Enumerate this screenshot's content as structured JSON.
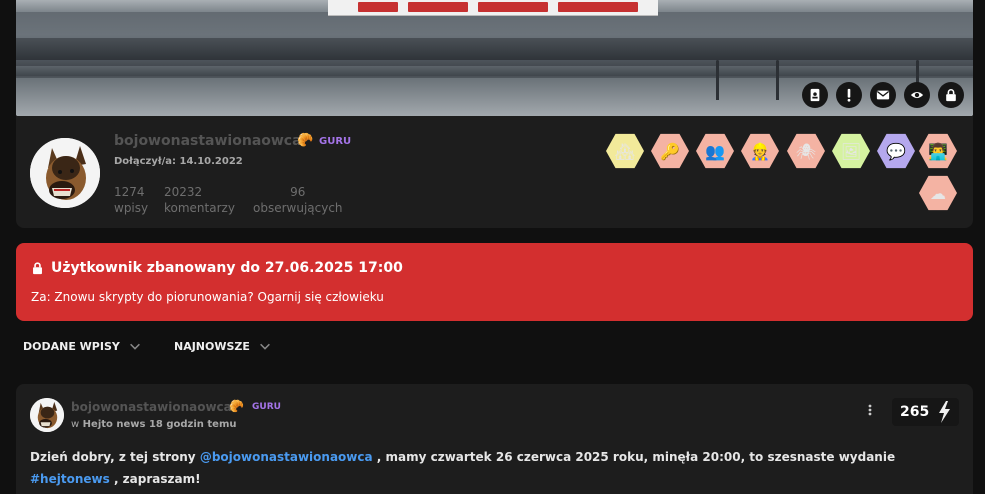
{
  "profile": {
    "username": "bojowonastawionaowca",
    "rank": "GURU",
    "joined": "Dołączył/a: 14.10.2022",
    "stats": [
      {
        "value": "1274",
        "label": "wpisy"
      },
      {
        "value": "20232",
        "label": "komentarzy"
      },
      {
        "value": "96",
        "label": "obserwujących"
      }
    ]
  },
  "banner_actions": [
    "contact-card-icon",
    "report-icon",
    "message-icon",
    "watch-icon",
    "block-icon"
  ],
  "badges": [
    {
      "icon": "house-badge-icon",
      "glyph": "🏘",
      "color": "#f2ea9a"
    },
    {
      "icon": "key-badge-icon",
      "glyph": "🔑",
      "color": "#f4b3a3"
    },
    {
      "icon": "people-badge-icon",
      "glyph": "👥",
      "color": "#f4b3a3"
    },
    {
      "icon": "worker-badge-icon",
      "glyph": "👷",
      "color": "#f4b3a3"
    },
    {
      "icon": "spider-badge-icon",
      "glyph": "🕷",
      "color": "#f4b3a3"
    },
    {
      "icon": "photo-badge-icon",
      "glyph": "🖼",
      "color": "#d5f2a0"
    },
    {
      "icon": "chat-badge-icon",
      "glyph": "💬",
      "color": "#b5a8ee"
    },
    {
      "icon": "desk-badge-icon",
      "glyph": "👨‍💻",
      "color": "#f4b3a3"
    },
    {
      "icon": "cloud-badge-icon",
      "glyph": "☁",
      "color": "#f4b3a3"
    }
  ],
  "ban": {
    "title": "Użytkownik zbanowany do 27.06.2025 17:00",
    "reason": "Za: Znowu skrypty do piorunowania? Ogarnij się człowieku"
  },
  "filters": {
    "type_label": "DODANE WPISY",
    "sort_label": "NAJNOWSZE"
  },
  "post": {
    "username": "bojowonastawionaowca",
    "rank": "GURU",
    "meta_prefix": "w",
    "meta": "Hejto news 18 godzin temu",
    "votes": "265",
    "text_1": "Dzień dobry, z tej strony",
    "mention": "@bojowonastawionaowca",
    "text_2": ", mamy czwartek 26 czerwca 2025 roku, minęła 20:00, to szesnaste wydanie",
    "hashtag": "#hejtonews",
    "text_3": ", zapraszam!"
  }
}
